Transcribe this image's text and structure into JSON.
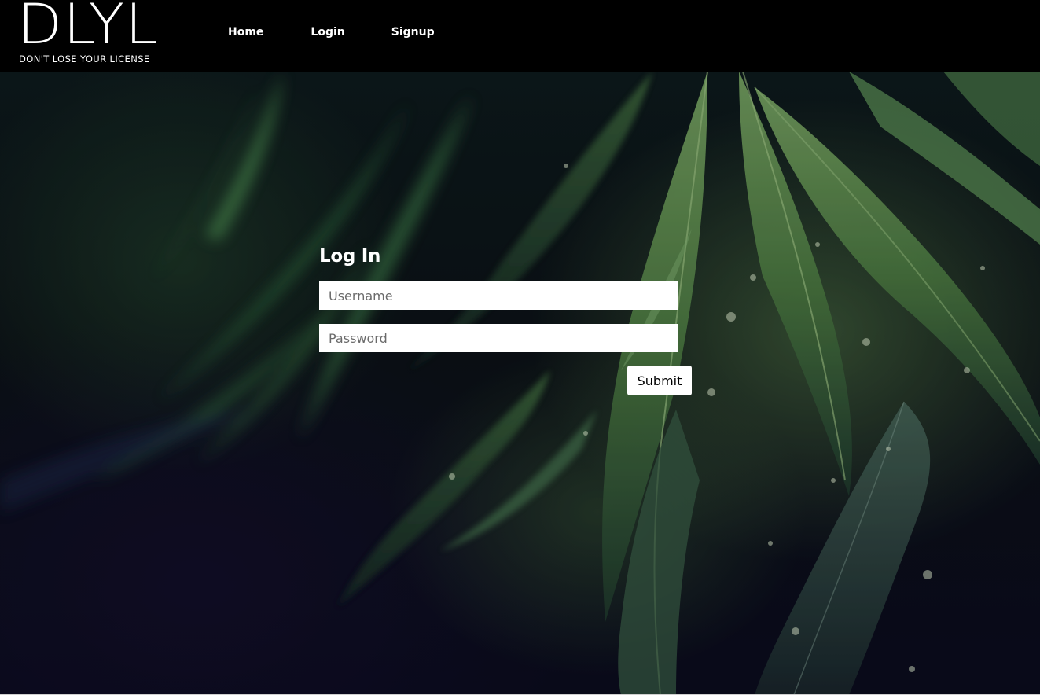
{
  "brand": {
    "mark": "DLYL",
    "tagline": "DON'T LOSE YOUR LICENSE"
  },
  "nav": {
    "items": [
      "Home",
      "Login",
      "Signup"
    ]
  },
  "login": {
    "title": "Log In",
    "username_placeholder": "Username",
    "password_placeholder": "Password",
    "submit_label": "Submit"
  },
  "colors": {
    "header_bg": "#000000",
    "field_bg": "#ffffff",
    "text_light": "#ffffff",
    "background_dark": "#0b1114",
    "leaf_green": "#5f8f4c"
  },
  "icons": {
    "background": "cannabis-leaves-background"
  }
}
